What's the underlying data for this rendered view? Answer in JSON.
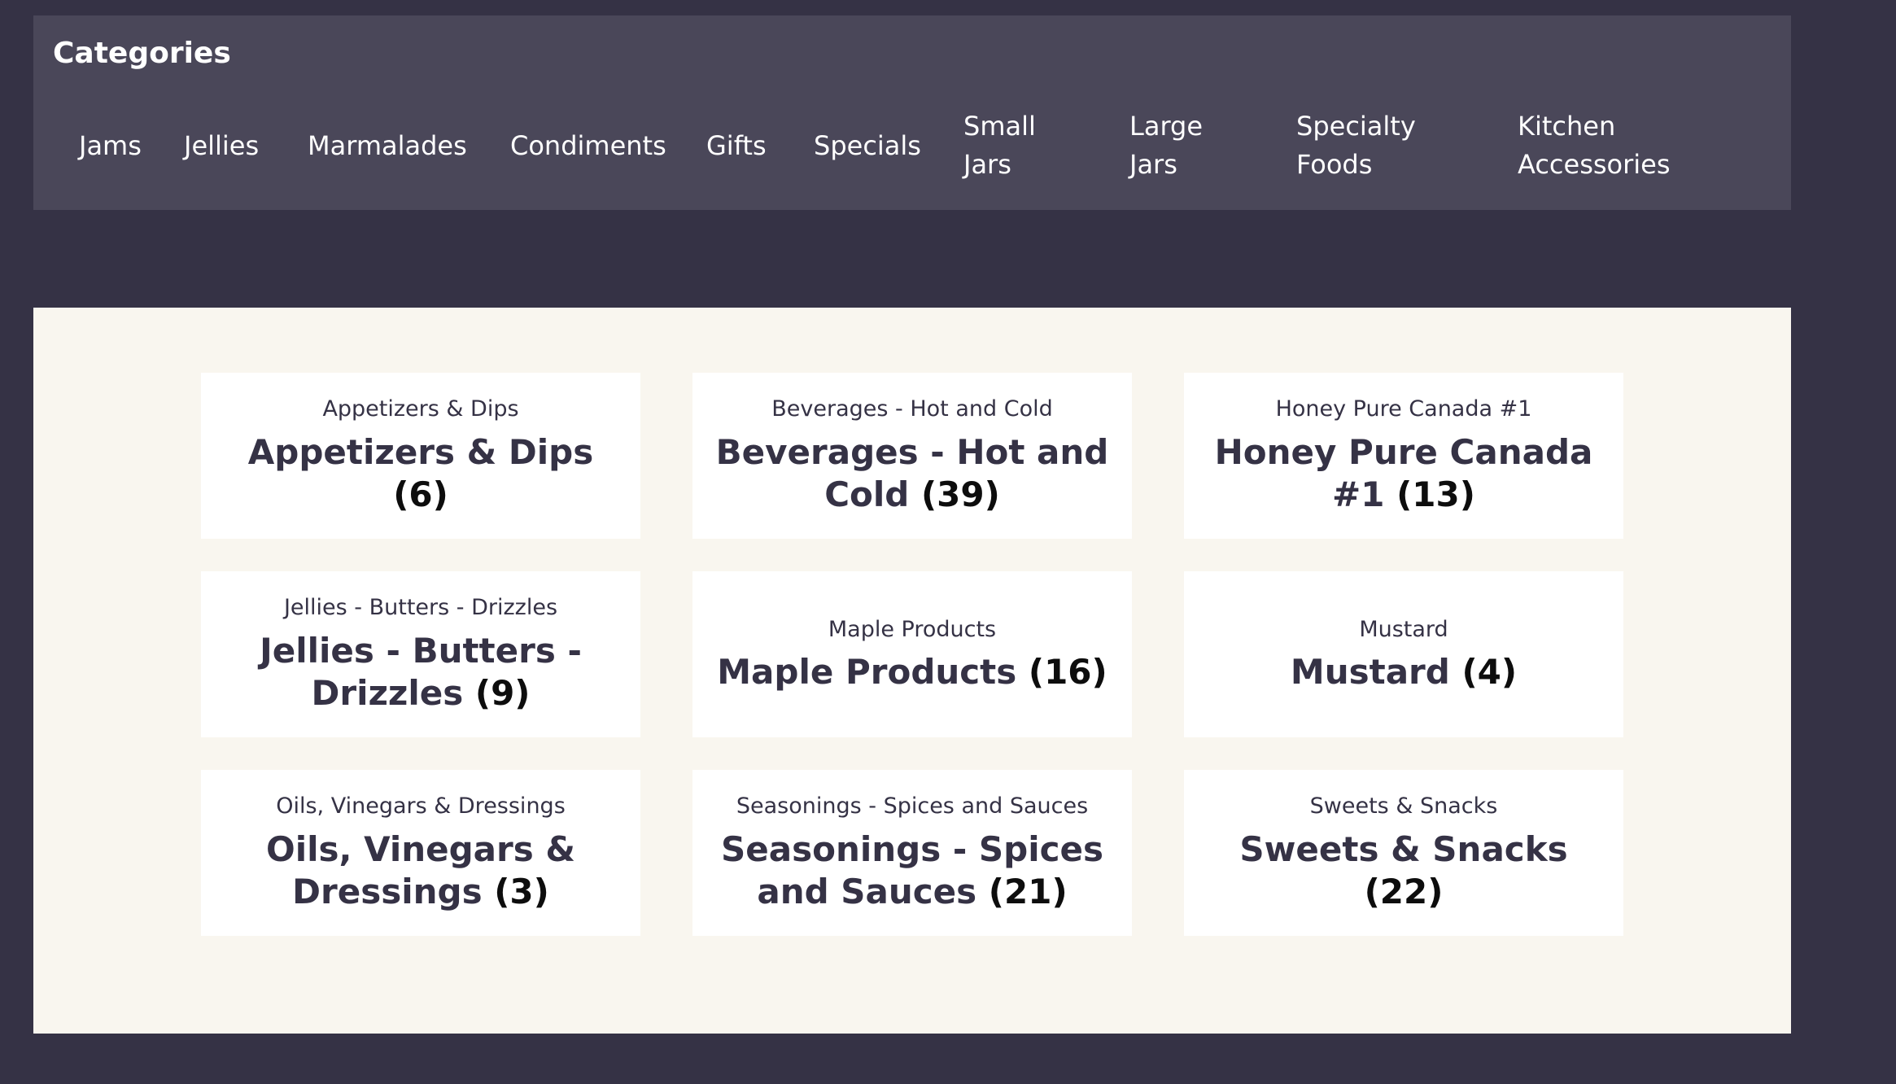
{
  "categories_panel": {
    "title": "Categories",
    "links": [
      {
        "label": "Jams"
      },
      {
        "label": "Jellies"
      },
      {
        "label": "Marmalades"
      },
      {
        "label": "Condiments"
      },
      {
        "label": "Gifts"
      },
      {
        "label": "Specials"
      },
      {
        "label": "Small Jars"
      },
      {
        "label": "Large Jars"
      },
      {
        "label": "Specialty Foods"
      },
      {
        "label": "Kitchen Accessories"
      }
    ]
  },
  "product_categories": [
    {
      "caption": "Appetizers & Dips",
      "name": "Appetizers & Dips",
      "count": "(6)"
    },
    {
      "caption": "Beverages - Hot and Cold",
      "name": "Beverages - Hot and Cold",
      "count": "(39)"
    },
    {
      "caption": "Honey Pure Canada #1",
      "name": "Honey Pure Canada #1",
      "count": "(13)"
    },
    {
      "caption": "Jellies - Butters - Drizzles",
      "name": "Jellies - Butters - Drizzles",
      "count": "(9)"
    },
    {
      "caption": "Maple Products",
      "name": "Maple Products",
      "count": "(16)"
    },
    {
      "caption": "Mustard",
      "name": "Mustard",
      "count": "(4)"
    },
    {
      "caption": "Oils, Vinegars & Dressings",
      "name": "Oils, Vinegars & Dressings",
      "count": "(3)"
    },
    {
      "caption": "Seasonings - Spices and Sauces",
      "name": "Seasonings - Spices and Sauces",
      "count": "(21)"
    },
    {
      "caption": "Sweets & Snacks",
      "name": "Sweets & Snacks",
      "count": "(22)"
    }
  ],
  "colors": {
    "page_background": "#353245",
    "panel_background": "#4a4759",
    "content_background": "#f9f6ef",
    "card_background": "#ffffff",
    "text_dark": "#353245"
  }
}
